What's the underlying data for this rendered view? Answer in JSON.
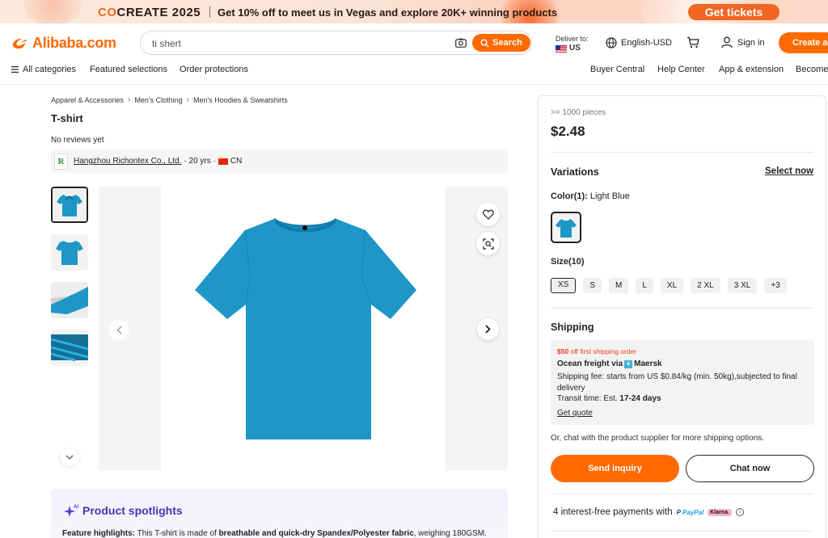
{
  "promo": {
    "brand_co": "CO",
    "brand_rest": "CREATE 2025",
    "text": "Get 10% off to meet us in Vegas and explore 20K+ winning products",
    "button": "Get tickets"
  },
  "header": {
    "logo": "Alibaba.com",
    "search_value": "ti shert",
    "search_button": "Search",
    "deliver_label": "Deliver to:",
    "deliver_country": "US",
    "language": "English-USD",
    "sign_in": "Sign in",
    "create_account": "Create ac"
  },
  "nav": {
    "all_categories": "All categories",
    "featured": "Featured selections",
    "order_protections": "Order protections",
    "buyer_central": "Buyer Central",
    "help_center": "Help Center",
    "app_extension": "App & extension",
    "become": "Become"
  },
  "breadcrumb": [
    "Apparel & Accessories",
    "Men's Clothing",
    "Men's Hoodies & Sweatshirts"
  ],
  "product": {
    "title": "T-shirt",
    "reviews": "No reviews yet",
    "supplier_name": "Hangzhou Richontex Co., Ltd.",
    "supplier_years": "· 20 yrs ·",
    "supplier_country": "CN"
  },
  "spotlight": {
    "title": "Product spotlights",
    "label": "Feature highlights:",
    "text1": " This T-shirt is made of ",
    "bold": "breathable and quick-dry Spandex/Polyester fabric",
    "text2": ", weighing 180GSM."
  },
  "purchase": {
    "moq": ">= 1000 pieces",
    "price": "$2.48",
    "variations_title": "Variations",
    "select_now": "Select now",
    "color_label": "Color(1):",
    "color_value": " Light Blue",
    "size_label": "Size(10)",
    "sizes": [
      "XS",
      "S",
      "M",
      "L",
      "XL",
      "2 XL",
      "3 XL",
      "+3"
    ],
    "shipping_title": "Shipping",
    "ship_promo_amount": "$50",
    "ship_promo_text": " off first shipping order",
    "freight_label": "Ocean freight via ",
    "carrier": "Maersk",
    "shipping_fee": "Shipping fee: starts from US $0.84/kg (min. 50kg),subjected to final delivery",
    "transit_label": "Transit time: Est. ",
    "transit_value": "17-24 days",
    "get_quote": "Get quote",
    "chat_note": "Or, chat with the product supplier for more shipping options.",
    "send_inquiry": "Send inquiry",
    "chat_now": "Chat now",
    "payments": "4 interest-free payments with",
    "paypal_a": "Pay",
    "paypal_b": "Pal",
    "klarna": "Klarna."
  },
  "colors": {
    "accent": "#ff6a00",
    "shirt": "#1e96c6",
    "spotlight": "#4a32b8"
  }
}
